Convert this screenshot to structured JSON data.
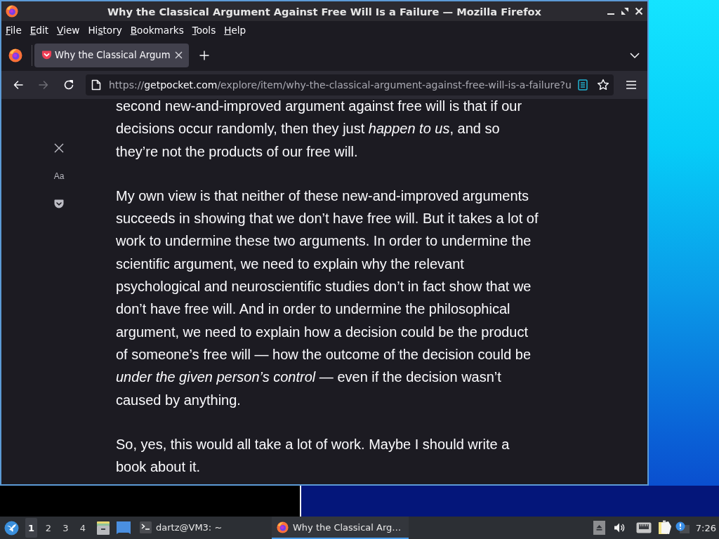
{
  "window": {
    "title": "Why the Classical Argument Against Free Will Is a Failure — Mozilla Firefox"
  },
  "menu_bar": [
    {
      "access_key": "F",
      "after": "ile"
    },
    {
      "access_key": "E",
      "after": "dit"
    },
    {
      "access_key": "V",
      "after": "iew"
    },
    {
      "before": "Hi",
      "access_key": "s",
      "after": "tory"
    },
    {
      "access_key": "B",
      "after": "ookmarks"
    },
    {
      "access_key": "T",
      "after": "ools"
    },
    {
      "access_key": "H",
      "after": "elp"
    }
  ],
  "tabs": [
    {
      "title": "Why the Classical Argum",
      "selected": true
    }
  ],
  "nav_buttons": [
    {
      "kind": "back",
      "disabled": false
    },
    {
      "kind": "forward",
      "disabled": true
    },
    {
      "kind": "reload",
      "disabled": false
    }
  ],
  "address_bar": {
    "scheme": "https://",
    "host": "getpocket.com",
    "path": "/explore/item/why-the-classical-argument-against-free-will-is-a-failure?u",
    "reader_view_active": true
  },
  "reader_toolbar": {
    "type_button": "Aa"
  },
  "article": {
    "paragraphs": [
      "second new-and-improved argument against free will is that if our decisions occur randomly, then they just *happen to us*, and so they’re not the products of our free will.",
      "My own view is that neither of these new-and-improved arguments succeeds in showing that we don’t have free will. But it takes a lot of work to undermine these two arguments. In order to undermine the scientific argument, we need to explain why the relevant psychological and neuroscientific studies don’t in fact show that we don’t have free will. And in order to undermine the philosophical argument, we need to explain how a decision could be the product of someone’s free will — how the outcome of the decision could be *under the given person’s control* — even if the decision wasn’t caused by anything.",
      "So, yes, this would all take a lot of work. Maybe I should write a book about it."
    ]
  },
  "taskbar": {
    "workspaces": [
      {
        "label": "1",
        "selected": true
      },
      {
        "label": "2",
        "selected": false
      },
      {
        "label": "3",
        "selected": false
      },
      {
        "label": "4",
        "selected": false
      }
    ],
    "tasks": [
      {
        "kind": "terminal",
        "label": "dartz@VM3: ~",
        "selected": false
      },
      {
        "kind": "browser",
        "label": "Why the Classical Arg…",
        "selected": true
      }
    ],
    "clock": "7:26"
  }
}
